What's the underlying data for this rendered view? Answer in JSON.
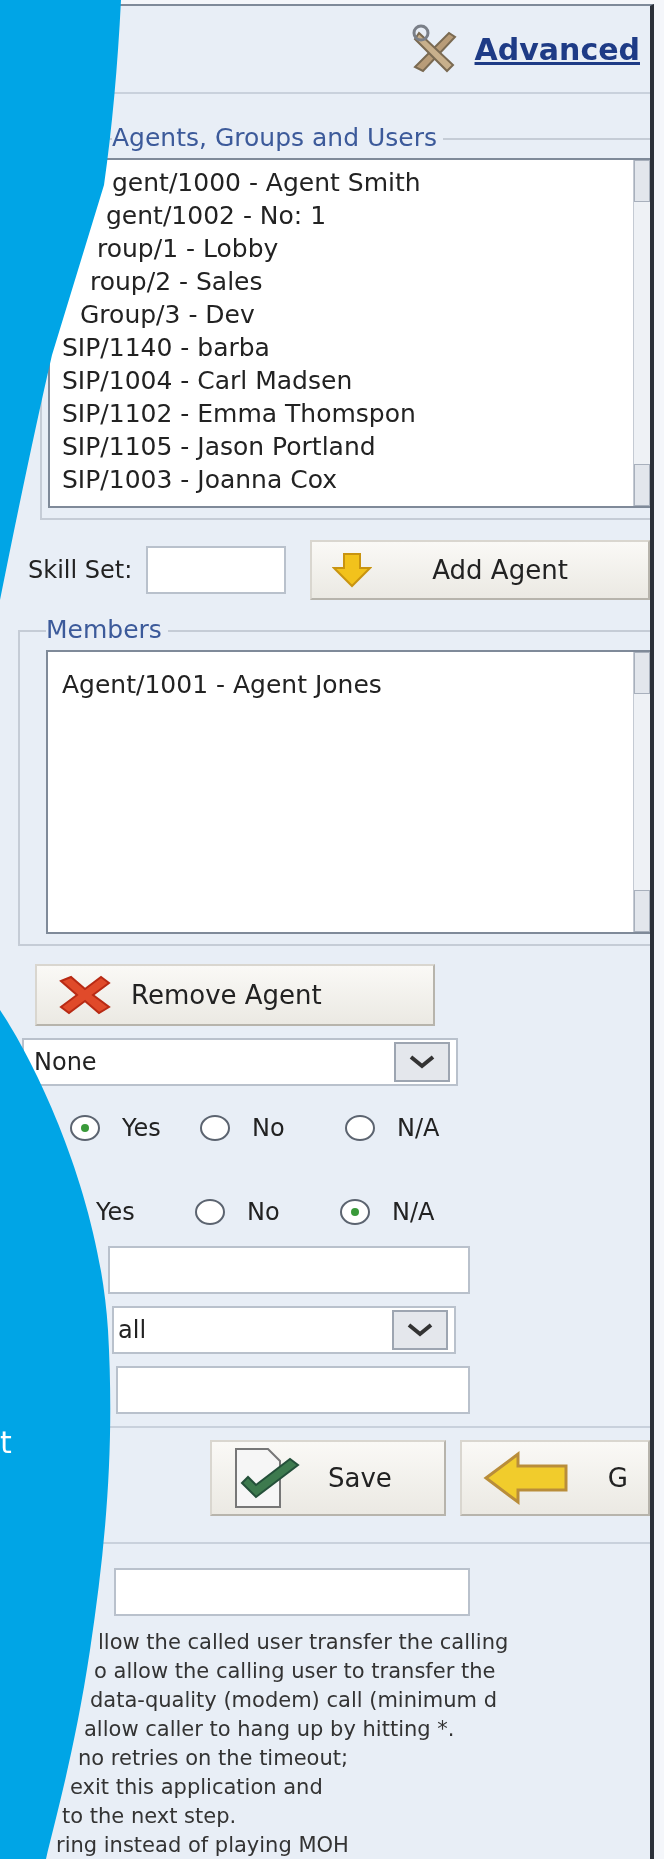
{
  "header": {
    "link": "Advanced"
  },
  "available": {
    "legend": "Agents, Groups and Users",
    "items": [
      {
        "label": "gent/1000 - Agent Smith",
        "selected": false
      },
      {
        "label": "gent/1002 - No: 1",
        "selected": false
      },
      {
        "label": "roup/1 - Lobby",
        "selected": false
      },
      {
        "label": "roup/2 - Sales",
        "selected": false
      },
      {
        "label": "Group/3 - Dev",
        "selected": false
      },
      {
        "label": "SIP/1140  - barba",
        "selected": false
      },
      {
        "label": "SIP/1004 - Carl Madsen",
        "selected": false
      },
      {
        "label": "SIP/1102 - Emma Thomspon",
        "selected": false
      },
      {
        "label": "SIP/1105 - Jason Portland",
        "selected": false
      },
      {
        "label": "SIP/1003 - Joanna Cox",
        "selected": false
      }
    ]
  },
  "skill_set": {
    "label": "Skill Set:"
  },
  "add_button": "Add Agent",
  "members": {
    "legend": "Members",
    "items": [
      {
        "label": "Agent/1001 - Agent Jones",
        "selected": false
      }
    ]
  },
  "remove_button": "Remove Agent",
  "select_1": {
    "value": "None"
  },
  "radio_groups": [
    {
      "options": [
        {
          "label": "Yes",
          "selected": true
        },
        {
          "label": "No",
          "selected": false
        },
        {
          "label": "N/A",
          "selected": false
        }
      ]
    },
    {
      "options": [
        {
          "label": "Yes"
        },
        {
          "label": "No",
          "selected": false
        },
        {
          "label": "N/A",
          "selected": true
        }
      ]
    }
  ],
  "select_2": {
    "value": "all"
  },
  "save_button": "Save",
  "go_button": "G",
  "help_lines": [
    "llow the called user transfer the calling",
    "o allow the calling user to transfer the",
    "data-quality (modem) call (minimum d",
    "allow caller to hang up by hitting *.",
    "no retries on the timeout;",
    "exit this application and",
    "to the next step.",
    "ring instead of playing MOH"
  ],
  "overlay": {
    "text": "t"
  }
}
